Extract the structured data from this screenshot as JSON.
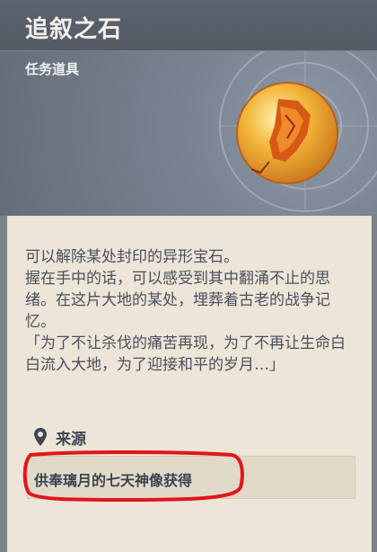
{
  "item": {
    "title": "追叙之石",
    "type": "任务道具",
    "description": [
      "可以解除某处封印的异形宝石。",
      "握在手中的话，可以感受到其中翻涌不止的思绪。在这片大地的某处，埋葬着古老的战争记忆。",
      "「为了不让杀伐的痛苦再现，为了不再让生命白白流入大地，为了迎接和平的岁月…」"
    ],
    "source_label": "来源",
    "source_text": "供奉璃月的七天神像获得"
  },
  "colors": {
    "header_bg": "#646c78",
    "body_bg": "#ece5d8",
    "text": "#4a505c",
    "highlight": "#e0161b",
    "orb": "#f0a42a"
  },
  "icons": {
    "item": "stone-orb-icon",
    "source": "location-pin-icon"
  }
}
